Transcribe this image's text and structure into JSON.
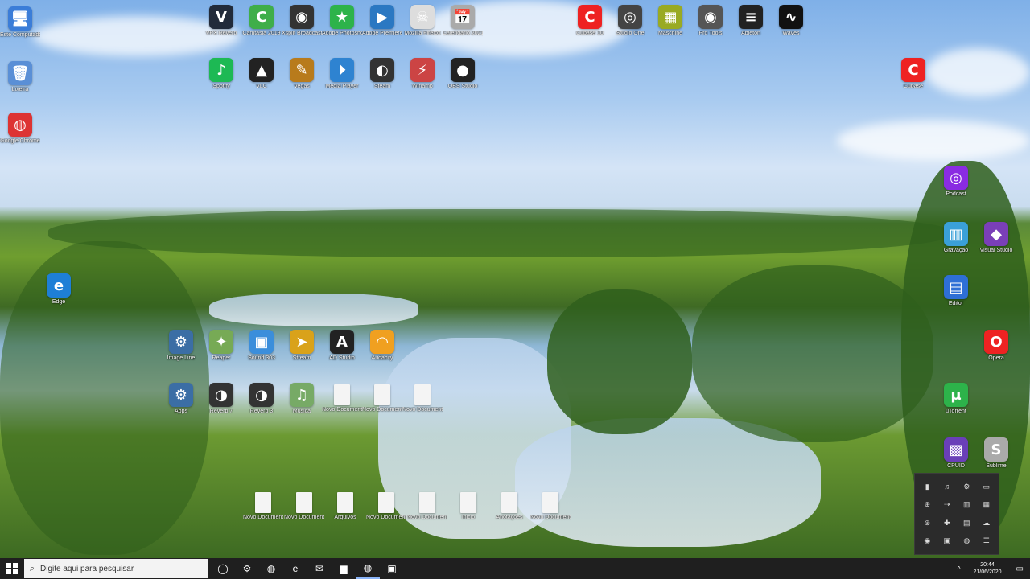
{
  "desktop": {
    "icons": [
      {
        "label": "Este Computador",
        "glyph": "🖥",
        "color": "#3b7dd8"
      },
      {
        "label": "VPX Reverb",
        "glyph": "V",
        "color": "#222b3a"
      },
      {
        "label": "Camtasia 2019",
        "glyph": "C",
        "color": "#3fae49"
      },
      {
        "label": "Xsplit Broadcaster",
        "glyph": "◉",
        "color": "#333"
      },
      {
        "label": "Adobe Photoshop",
        "glyph": "★",
        "color": "#2db34a"
      },
      {
        "label": "Adobe Premiere",
        "glyph": "▶",
        "color": "#2b78c2"
      },
      {
        "label": "Mozilla Firefox",
        "glyph": "☠",
        "color": "#ddd"
      },
      {
        "label": "Calendário 2021",
        "glyph": "📅",
        "color": "#aaa"
      },
      {
        "label": "Lixeira",
        "glyph": "🗑",
        "color": "#5a8fd6"
      },
      {
        "label": "Spotify",
        "glyph": "♪",
        "color": "#1db954"
      },
      {
        "label": "VLC",
        "glyph": "▲",
        "color": "#222"
      },
      {
        "label": "Vegas",
        "glyph": "✎",
        "color": "#b87b1c"
      },
      {
        "label": "Media Player",
        "glyph": "⏵",
        "color": "#2e83d1"
      },
      {
        "label": "Steam",
        "glyph": "◐",
        "color": "#333"
      },
      {
        "label": "Winamp",
        "glyph": "⚡",
        "color": "#c44"
      },
      {
        "label": "OBS Studio",
        "glyph": "●",
        "color": "#222"
      },
      {
        "label": "Google Chrome",
        "glyph": "◍",
        "color": "#d33"
      },
      {
        "label": "Edge",
        "glyph": "e",
        "color": "#1e7fd6"
      }
    ],
    "grid_icons": [
      {
        "label": "Image Line",
        "glyph": "⚙",
        "color": "#3b6ea5"
      },
      {
        "label": "Reaper",
        "glyph": "✦",
        "color": "#7a5"
      },
      {
        "label": "Sound 303",
        "glyph": "▣",
        "color": "#3b8edb"
      },
      {
        "label": "Stream",
        "glyph": "➤",
        "color": "#d9a21a"
      },
      {
        "label": "AD Studio",
        "glyph": "A",
        "color": "#222"
      },
      {
        "label": "Audacity",
        "glyph": "◠",
        "color": "#f0a020"
      },
      {
        "label": "Apps",
        "glyph": "⚙",
        "color": "#3b6ea5"
      },
      {
        "label": "Reverb 7",
        "glyph": "◑",
        "color": "#333"
      },
      {
        "label": "Reverb 3",
        "glyph": "◑",
        "color": "#333"
      },
      {
        "label": "Música",
        "glyph": "♫",
        "color": "#7a6"
      },
      {
        "label": "Novo Documento",
        "glyph": "",
        "color": "#f4f4f4"
      },
      {
        "label": "Novo Documento",
        "glyph": "",
        "color": "#f4f4f4"
      },
      {
        "label": "Novo Documento",
        "glyph": "",
        "color": "#f4f4f4"
      }
    ],
    "bottom_docs": [
      "Novo Documento",
      "Novo Documento",
      "Arquivos",
      "Novo Documento",
      "Novo Documento",
      "Inicio",
      "Anotações",
      "Novo Documento"
    ],
    "right_icons": [
      {
        "label": "Cubase 10",
        "glyph": "C",
        "color": "#e22"
      },
      {
        "label": "Studio One",
        "glyph": "◎",
        "color": "#444"
      },
      {
        "label": "Maschine",
        "glyph": "▦",
        "color": "#9a2"
      },
      {
        "label": "Pro Tools",
        "glyph": "◉",
        "color": "#555"
      },
      {
        "label": "Ableton",
        "glyph": "≡",
        "color": "#222"
      },
      {
        "label": "Waves",
        "glyph": "∿",
        "color": "#111"
      },
      {
        "label": "Cubase",
        "glyph": "C",
        "color": "#e22"
      },
      {
        "label": "Podcast",
        "glyph": "◎",
        "color": "#8a2be2"
      },
      {
        "label": "Gravação",
        "glyph": "▥",
        "color": "#3aa0d8"
      },
      {
        "label": "Visual Studio",
        "glyph": "◆",
        "color": "#7a3fb8"
      },
      {
        "label": "Editor",
        "glyph": "▤",
        "color": "#2e6fd6"
      },
      {
        "label": "uTorrent",
        "glyph": "μ",
        "color": "#2db34a"
      },
      {
        "label": "Opera",
        "glyph": "O",
        "color": "#e22"
      },
      {
        "label": "CPUID",
        "glyph": "▩",
        "color": "#6a3fb8"
      },
      {
        "label": "Sublime",
        "glyph": "S",
        "color": "#aaa"
      }
    ]
  },
  "taskbar": {
    "search_placeholder": "Digite aqui para pesquisar",
    "apps": [
      {
        "name": "task-view-icon",
        "glyph": "◯"
      },
      {
        "name": "settings-icon",
        "glyph": "⚙"
      },
      {
        "name": "chrome-icon",
        "glyph": "◍"
      },
      {
        "name": "edge-icon",
        "glyph": "e"
      },
      {
        "name": "mail-icon",
        "glyph": "✉"
      },
      {
        "name": "folder-icon",
        "glyph": "▆"
      },
      {
        "name": "chrome-active-icon",
        "glyph": "◍"
      },
      {
        "name": "store-icon",
        "glyph": "▣"
      }
    ],
    "time": "20:44",
    "date": "21/06/2020"
  },
  "tray_panel_icons": [
    "▮",
    "♫",
    "⚙",
    "▭",
    "⊕",
    "⇢",
    "▥",
    "▦",
    "⊛",
    "✚",
    "▤",
    "☁",
    "◉",
    "▣",
    "◍",
    "☰"
  ]
}
